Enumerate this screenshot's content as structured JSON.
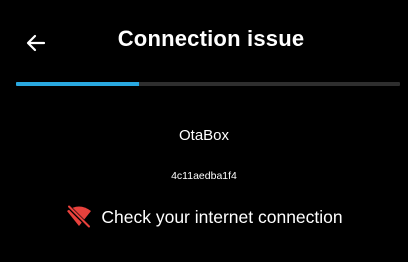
{
  "header": {
    "title": "Connection issue",
    "back_icon": "arrow-left-icon"
  },
  "progress": {
    "value_percent": 32,
    "color": "#29a8e0",
    "track_color": "#2e2e2e"
  },
  "device": {
    "name": "OtaBox",
    "id": "4c11aedba1f4"
  },
  "status": {
    "icon": "wifi-off-icon",
    "icon_color": "#e8413c",
    "message": "Check your internet connection"
  }
}
